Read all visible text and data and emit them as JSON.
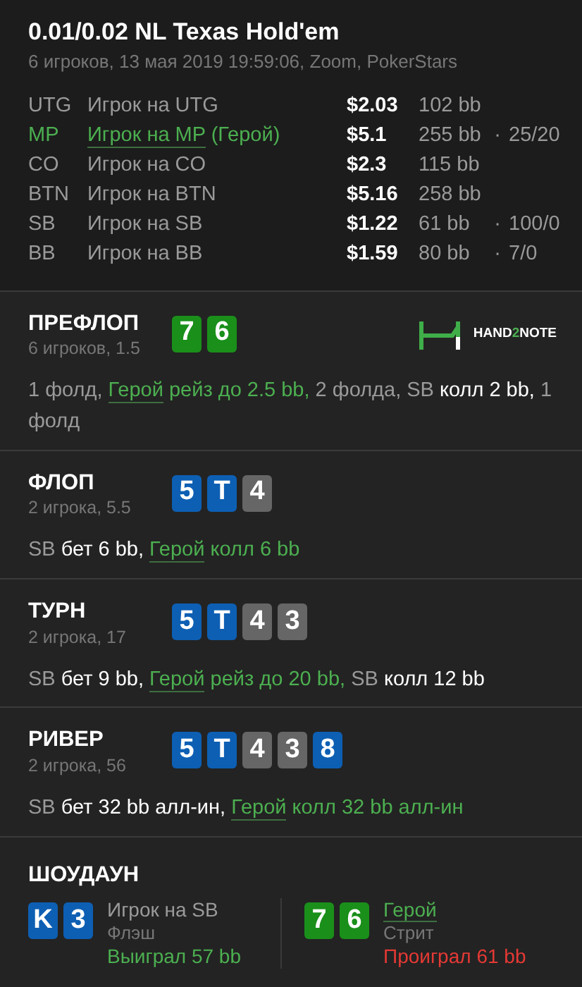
{
  "header": {
    "title": "0.01/0.02 NL Texas Hold'em",
    "subtitle": "6 игроков, 13 мая 2019 19:59:06, Zoom, PokerStars"
  },
  "players": [
    {
      "position": "UTG",
      "name": "Игрок на UTG",
      "hero": false,
      "stack": "$2.03",
      "bb": "102 bb"
    },
    {
      "position": "MP",
      "name": "Игрок на MP",
      "hero": true,
      "hero_tag": "(Герой)",
      "stack": "$5.1",
      "bb": "255 bb",
      "separator": "·",
      "stats": "25/20"
    },
    {
      "position": "CO",
      "name": "Игрок на CO",
      "hero": false,
      "stack": "$2.3",
      "bb": "115 bb"
    },
    {
      "position": "BTN",
      "name": "Игрок на BTN",
      "hero": false,
      "stack": "$5.16",
      "bb": "258 bb"
    },
    {
      "position": "SB",
      "name": "Игрок на SB",
      "hero": false,
      "stack": "$1.22",
      "bb": "61 bb",
      "separator": "·",
      "stats": "100/0"
    },
    {
      "position": "BB",
      "name": "Игрок на BB",
      "hero": false,
      "stack": "$1.59",
      "bb": "80 bb",
      "separator": "·",
      "stats": "7/0"
    }
  ],
  "streets": [
    {
      "title": "ПРЕФЛОП",
      "info": "6 игроков, 1.5",
      "logo": {
        "prefix": "HAND",
        "accent": "2",
        "suffix": "NOTE"
      },
      "cards": [
        {
          "rank": "7",
          "color": "#1a8f1a"
        },
        {
          "rank": "6",
          "color": "#1a8f1a"
        }
      ],
      "actions": [
        {
          "kind": "muted",
          "text": "1 фолд, "
        },
        {
          "kind": "hero",
          "text": "Герой"
        },
        {
          "kind": "green",
          "text": " рейз до 2.5 bb,"
        },
        {
          "kind": "muted",
          "text": " 2 фолда, SB"
        },
        {
          "kind": "bright",
          "text": " колл 2 bb,"
        },
        {
          "kind": "muted",
          "text": " 1 фолд"
        }
      ]
    },
    {
      "title": "ФЛОП",
      "info": "2 игрока, 5.5",
      "cards": [
        {
          "rank": "5",
          "color": "#0d5fb3"
        },
        {
          "rank": "T",
          "color": "#0d5fb3"
        },
        {
          "rank": "4",
          "color": "#666666"
        }
      ],
      "actions": [
        {
          "kind": "muted",
          "text": "SB"
        },
        {
          "kind": "bright",
          "text": " бет 6 bb, "
        },
        {
          "kind": "hero",
          "text": "Герой"
        },
        {
          "kind": "green",
          "text": " колл 6 bb"
        }
      ]
    },
    {
      "title": "ТУРН",
      "info": "2 игрока, 17",
      "cards": [
        {
          "rank": "5",
          "color": "#0d5fb3"
        },
        {
          "rank": "T",
          "color": "#0d5fb3"
        },
        {
          "rank": "4",
          "color": "#666666"
        },
        {
          "rank": "3",
          "color": "#666666"
        }
      ],
      "actions": [
        {
          "kind": "muted",
          "text": "SB"
        },
        {
          "kind": "bright",
          "text": " бет 9 bb, "
        },
        {
          "kind": "hero",
          "text": "Герой"
        },
        {
          "kind": "green",
          "text": " рейз до 20 bb,"
        },
        {
          "kind": "muted",
          "text": " SB"
        },
        {
          "kind": "bright",
          "text": " колл 12 bb"
        }
      ]
    },
    {
      "title": "РИВЕР",
      "info": "2 игрока, 56",
      "cards": [
        {
          "rank": "5",
          "color": "#0d5fb3"
        },
        {
          "rank": "T",
          "color": "#0d5fb3"
        },
        {
          "rank": "4",
          "color": "#666666"
        },
        {
          "rank": "3",
          "color": "#666666"
        },
        {
          "rank": "8",
          "color": "#0d5fb3"
        }
      ],
      "actions": [
        {
          "kind": "muted",
          "text": "SB"
        },
        {
          "kind": "bright",
          "text": " бет 32 bb алл-ин, "
        },
        {
          "kind": "hero",
          "text": "Герой"
        },
        {
          "kind": "green",
          "text": " колл 32 bb алл-ин"
        }
      ]
    }
  ],
  "showdown": {
    "title": "ШОУДАУН",
    "hands": [
      {
        "cards": [
          {
            "rank": "K",
            "color": "#0d5fb3"
          },
          {
            "rank": "3",
            "color": "#0d5fb3"
          }
        ],
        "name": "Игрок на SB",
        "hero": false,
        "hand": "Флэш",
        "result": "Выиграл 57 bb",
        "won": true
      },
      {
        "cards": [
          {
            "rank": "7",
            "color": "#1a8f1a"
          },
          {
            "rank": "6",
            "color": "#1a8f1a"
          }
        ],
        "name": "Герой",
        "hero": true,
        "hand": "Стрит",
        "result": "Проиграл 61 bb",
        "won": false
      }
    ]
  }
}
